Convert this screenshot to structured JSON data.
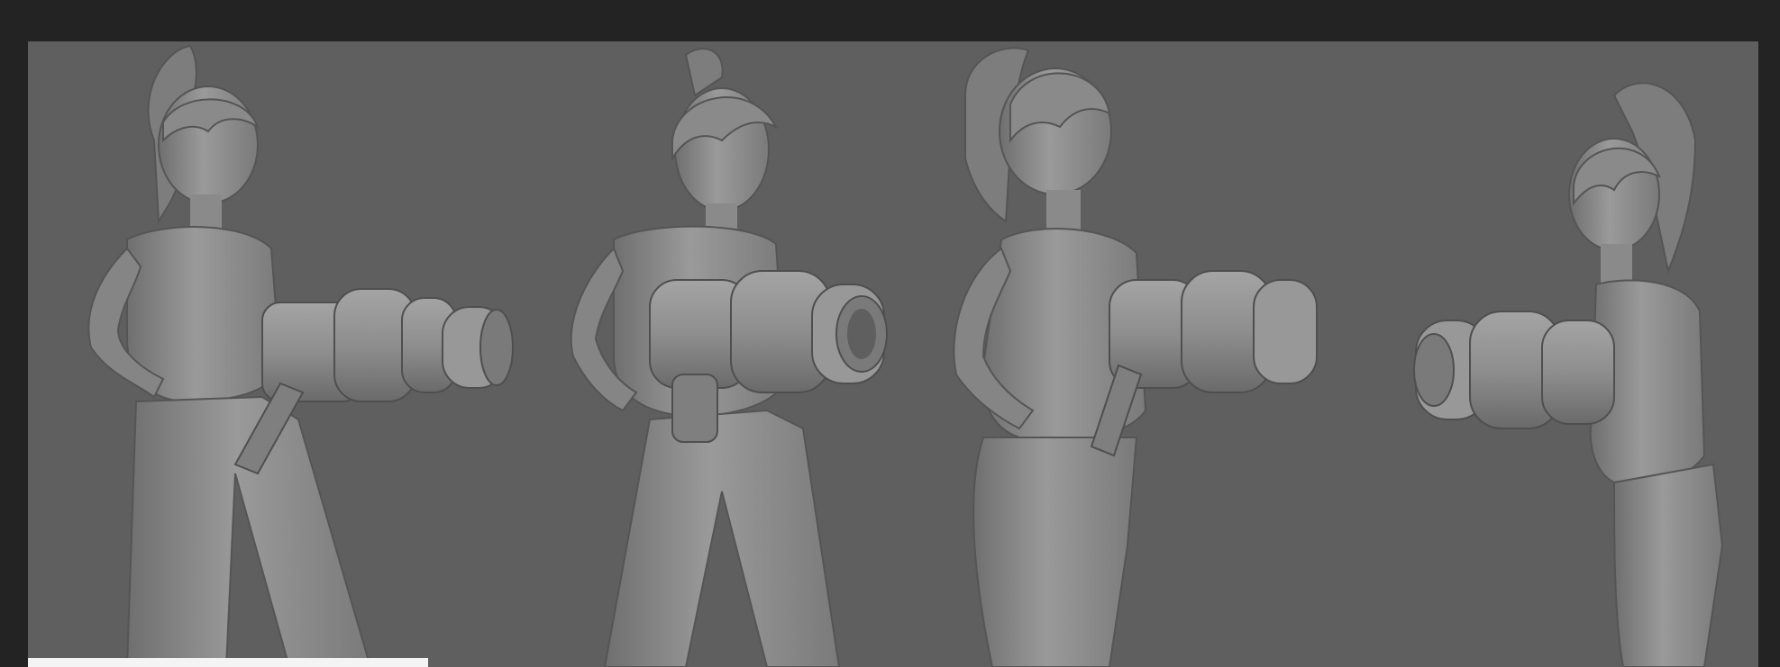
{
  "scene": {
    "background_color": "#232323",
    "viewport_color": "#5f5f5f",
    "model_color": "#8c8c8c",
    "subject": "character-sculpt-turnaround",
    "views": [
      {
        "id": "view-1"
      },
      {
        "id": "view-2"
      },
      {
        "id": "view-3"
      },
      {
        "id": "view-4"
      }
    ]
  }
}
